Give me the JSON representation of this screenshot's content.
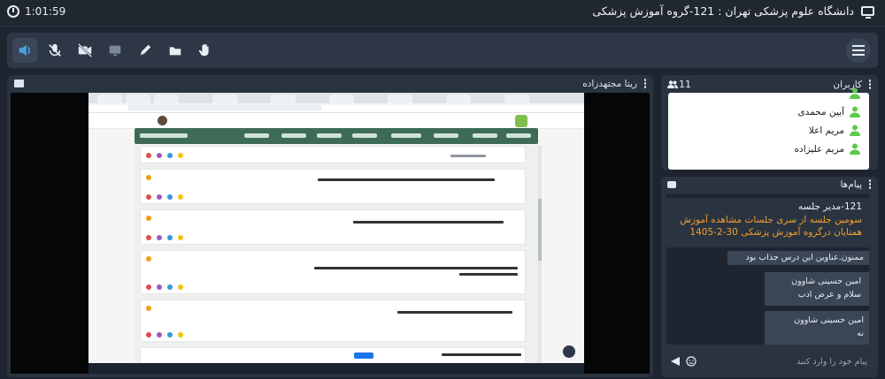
{
  "header": {
    "timer": "1:01:59",
    "title": "دانشگاه علوم پزشکی تهران : 121-گروه آموزش پزشکی"
  },
  "toolbar": {
    "tools": [
      "speaker-icon",
      "mic-off-icon",
      "camera-off-icon",
      "screen-share-icon",
      "pen-icon",
      "folder-icon",
      "raise-hand-icon"
    ],
    "menu_icon": "hamburger-icon"
  },
  "video": {
    "presenter_name": "ریتا مجتهدزاده"
  },
  "users": {
    "label": "کاربران",
    "count": "11",
    "list": [
      {
        "name": "آیین محمدی"
      },
      {
        "name": "مریم اعلا"
      },
      {
        "name": "مریم علیزاده"
      }
    ]
  },
  "messages": {
    "label": "پیام‌ها",
    "items": [
      {
        "sender": "121-مدیر جلسه",
        "text": "سومین جلسه از سری جلسات مشاهده آموزش همتایان درگروه آموزش پزشکی 30-2-1405"
      },
      {
        "text": "ممنون.عناوین این درس جذاب بود"
      },
      {
        "sender": "امین حسینی شاوون",
        "text": "سلام و عرض ادب"
      },
      {
        "sender": "امین حسینی شاوون",
        "text": "نه"
      }
    ],
    "input_placeholder": "پیام خود را وارد کنید"
  },
  "colors": {
    "background": "#1e2530",
    "panel": "#2a3340",
    "accent": "#4aa3df",
    "online": "#5cc94a",
    "highlight_text": "#f0a030"
  }
}
